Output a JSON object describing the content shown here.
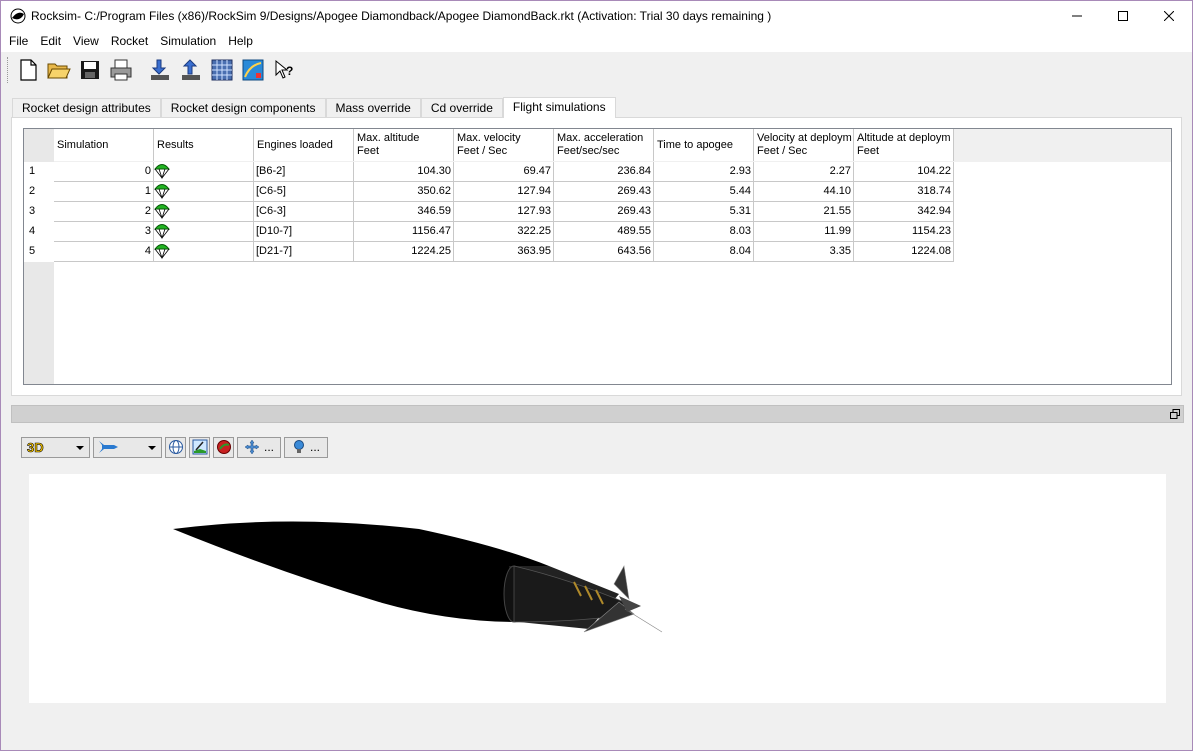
{
  "window": {
    "title": "Rocksim- C:/Program Files (x86)/RockSim 9/Designs/Apogee Diamondback/Apogee DiamondBack.rkt  (Activation: Trial 30 days remaining )",
    "minimize_glyph": "—",
    "maximize_glyph": "☐",
    "close_glyph": "✕"
  },
  "menu": [
    "File",
    "Edit",
    "View",
    "Rocket",
    "Simulation",
    "Help"
  ],
  "toolbar": {
    "buttons": [
      "new-file-icon",
      "open-folder-icon",
      "save-disk-icon",
      "print-icon",
      "export-icon",
      "import-icon",
      "grid-icon",
      "wind-icon",
      "help-pointer-icon"
    ]
  },
  "tabs": [
    {
      "label": "Rocket design attributes",
      "active": false
    },
    {
      "label": "Rocket design components",
      "active": false
    },
    {
      "label": "Mass override",
      "active": false
    },
    {
      "label": "Cd override",
      "active": false
    },
    {
      "label": "Flight simulations",
      "active": true
    }
  ],
  "grid": {
    "headers": [
      {
        "line1": "Simulation",
        "line2": ""
      },
      {
        "line1": "Results",
        "line2": ""
      },
      {
        "line1": "Engines loaded",
        "line2": ""
      },
      {
        "line1": "Max. altitude",
        "line2": "Feet"
      },
      {
        "line1": "Max. velocity",
        "line2": "Feet / Sec"
      },
      {
        "line1": "Max. acceleration",
        "line2": "Feet/sec/sec"
      },
      {
        "line1": "Time to apogee",
        "line2": ""
      },
      {
        "line1": "Velocity at deploym",
        "line2": "Feet / Sec"
      },
      {
        "line1": "Altitude at deploym",
        "line2": "Feet"
      }
    ],
    "rows": [
      {
        "row": "1",
        "sim": "0",
        "engine": "[B6-2]",
        "max_alt": "104.30",
        "max_vel": "69.47",
        "max_acc": "236.84",
        "t_apogee": "2.93",
        "vel_deploy": "2.27",
        "alt_deploy": "104.22",
        "status": "success"
      },
      {
        "row": "2",
        "sim": "1",
        "engine": "[C6-5]",
        "max_alt": "350.62",
        "max_vel": "127.94",
        "max_acc": "269.43",
        "t_apogee": "5.44",
        "vel_deploy": "44.10",
        "alt_deploy": "318.74",
        "status": "success"
      },
      {
        "row": "3",
        "sim": "2",
        "engine": "[C6-3]",
        "max_alt": "346.59",
        "max_vel": "127.93",
        "max_acc": "269.43",
        "t_apogee": "5.31",
        "vel_deploy": "21.55",
        "alt_deploy": "342.94",
        "status": "success"
      },
      {
        "row": "4",
        "sim": "3",
        "engine": "[D10-7]",
        "max_alt": "1156.47",
        "max_vel": "322.25",
        "max_acc": "489.55",
        "t_apogee": "8.03",
        "vel_deploy": "11.99",
        "alt_deploy": "1154.23",
        "status": "success"
      },
      {
        "row": "5",
        "sim": "4",
        "engine": "[D21-7]",
        "max_alt": "1224.25",
        "max_vel": "363.95",
        "max_acc": "643.56",
        "t_apogee": "8.04",
        "vel_deploy": "3.35",
        "alt_deploy": "1224.08",
        "status": "success"
      }
    ]
  },
  "view3d": {
    "mode_label": "3D",
    "ellipsis": "..."
  },
  "colors": {
    "chute_green": "#22b422",
    "mode_label_yellow": "#ffcc00"
  }
}
